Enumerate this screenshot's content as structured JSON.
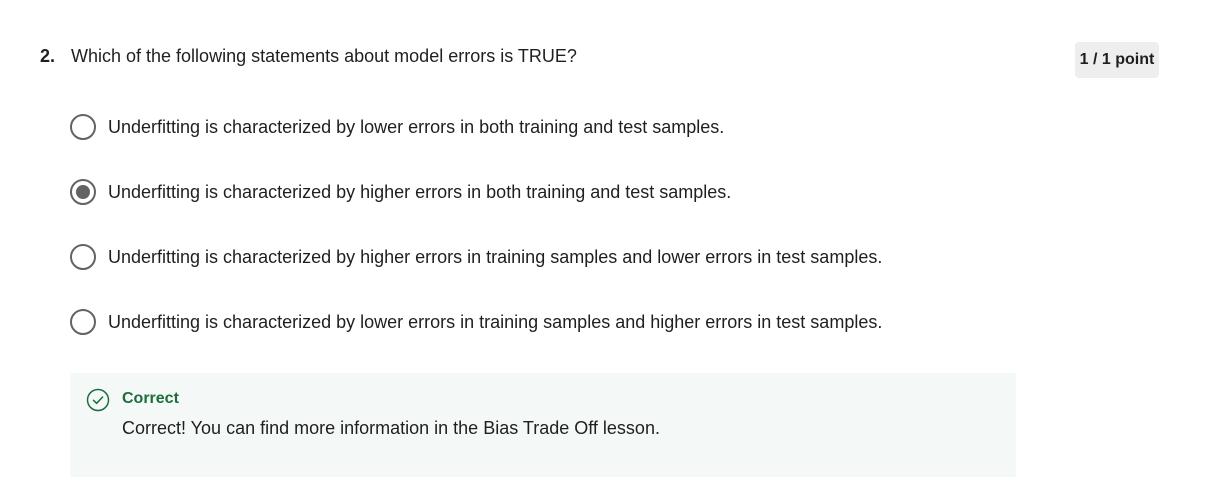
{
  "question": {
    "number": "2.",
    "text": "Which of the following statements about model errors is TRUE?"
  },
  "score": {
    "label": "1 / 1 point"
  },
  "options": [
    {
      "label": "Underfitting is characterized by lower errors in both training and test samples.",
      "selected": false
    },
    {
      "label": "Underfitting is characterized by higher errors in both training and test samples.",
      "selected": true
    },
    {
      "label": "Underfitting is characterized by higher errors in training samples and lower errors in test samples.",
      "selected": false
    },
    {
      "label": "Underfitting is characterized by lower errors in training samples and higher errors in test samples.",
      "selected": false
    }
  ],
  "feedback": {
    "status": "Correct",
    "message": "Correct! You can find more information in the Bias Trade Off lesson.",
    "icon": "check-circle-icon",
    "color": "#1b6e3b"
  },
  "colors": {
    "radio": "#636363",
    "feedback_bg": "#f4f8f6",
    "badge_bg": "#eeeeee"
  }
}
